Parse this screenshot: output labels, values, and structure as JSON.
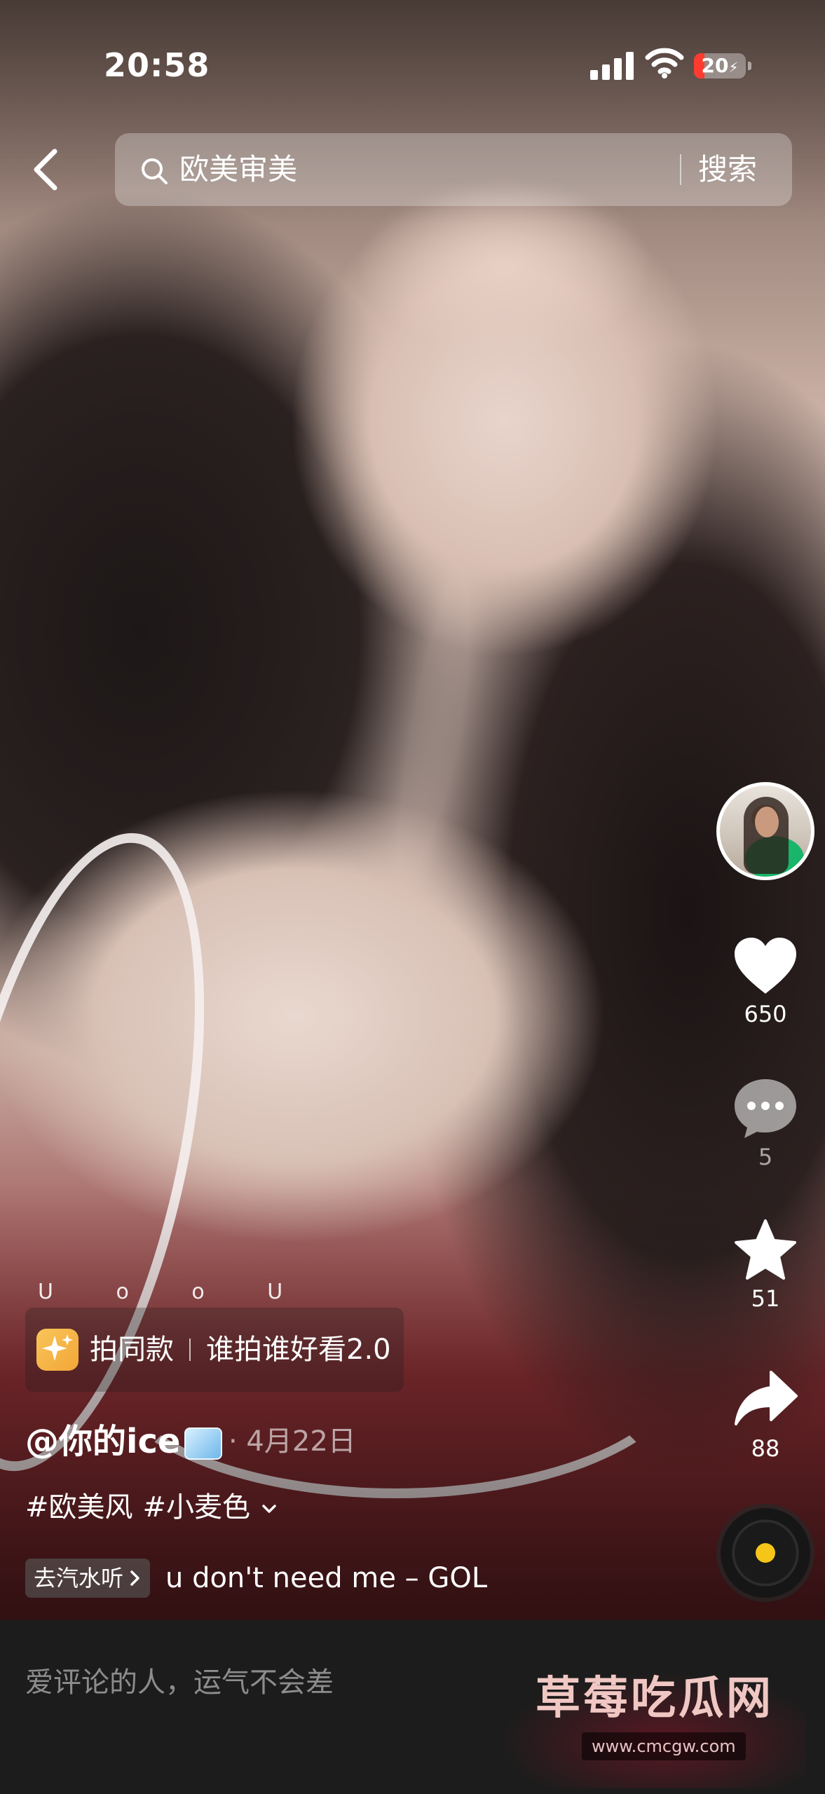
{
  "status_bar": {
    "time": "20:58",
    "battery_level": "20",
    "battery_symbol": "⚡"
  },
  "search": {
    "query": "欧美审美",
    "button_label": "搜索"
  },
  "actions": {
    "like_count": "650",
    "comment_count": "5",
    "favorite_count": "51",
    "share_count": "88"
  },
  "effect": {
    "hint": "U o o U",
    "label": "拍同款",
    "name": "谁拍谁好看2.0"
  },
  "post": {
    "author": "@你的ice",
    "date": "· 4月22日",
    "tags": [
      "#欧美风",
      "#小麦色"
    ]
  },
  "music": {
    "chip_label": "去汽水听",
    "title": "u don't need me – GOL"
  },
  "comment": {
    "placeholder": "爱评论的人，运气不会差"
  },
  "watermark": {
    "title": "草莓吃瓜网",
    "url": "www.cmcgw.com"
  },
  "colors": {
    "battery_low": "#ff3b30",
    "music_disc_center": "#f5c518",
    "comment_bar_bg": "#1c1c1c"
  }
}
